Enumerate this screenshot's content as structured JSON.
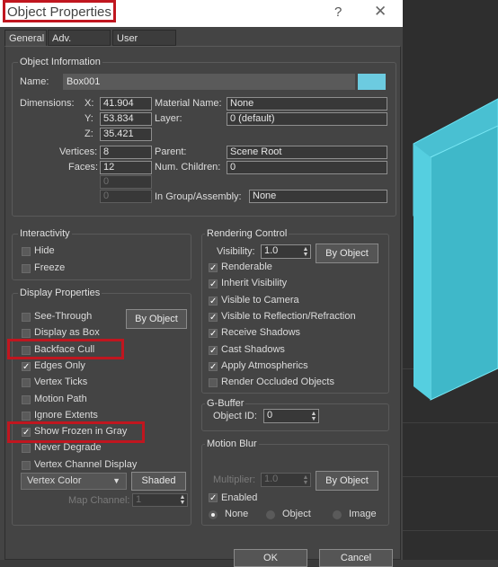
{
  "window": {
    "title": "Object Properties",
    "help": "?",
    "close": "✕"
  },
  "tabs": [
    "General",
    "Adv. Lighting",
    "User Defined"
  ],
  "object_info": {
    "group_title": "Object Information",
    "name_label": "Name:",
    "name_value": "Box001",
    "color": "#6ccbe0",
    "dimensions_label": "Dimensions:",
    "x_label": "X:",
    "x_value": "41.904",
    "y_label": "Y:",
    "y_value": "53.834",
    "z_label": "Z:",
    "z_value": "35.421",
    "material_label": "Material Name:",
    "material_value": "None",
    "layer_label": "Layer:",
    "layer_value": "0 (default)",
    "vertices_label": "Vertices:",
    "vertices_value": "8",
    "faces_label": "Faces:",
    "faces_value": "12",
    "extra1_value": "0",
    "extra2_value": "0",
    "parent_label": "Parent:",
    "parent_value": "Scene Root",
    "children_label": "Num. Children:",
    "children_value": "0",
    "group_label": "In Group/Assembly:",
    "group_value": "None"
  },
  "interactivity": {
    "title": "Interactivity",
    "items": [
      {
        "label": "Hide",
        "checked": false
      },
      {
        "label": "Freeze",
        "checked": false
      }
    ]
  },
  "display": {
    "title": "Display Properties",
    "by_object": "By Object",
    "items": [
      {
        "label": "See-Through",
        "checked": false
      },
      {
        "label": "Display as Box",
        "checked": false
      },
      {
        "label": "Backface Cull",
        "checked": false
      },
      {
        "label": "Edges Only",
        "checked": true
      },
      {
        "label": "Vertex Ticks",
        "checked": false
      },
      {
        "label": "Motion Path",
        "checked": false
      },
      {
        "label": "Ignore Extents",
        "checked": false
      },
      {
        "label": "Show Frozen in Gray",
        "checked": true
      },
      {
        "label": "Never Degrade",
        "checked": false
      },
      {
        "label": "Vertex Channel Display",
        "checked": false
      }
    ],
    "vertex_color": "Vertex Color",
    "shaded": "Shaded",
    "map_channel_label": "Map Channel:",
    "map_channel_value": "1"
  },
  "rendering": {
    "title": "Rendering Control",
    "visibility_label": "Visibility:",
    "visibility_value": "1.0",
    "by_object": "By Object",
    "items": [
      {
        "label": "Renderable",
        "checked": true
      },
      {
        "label": "Inherit Visibility",
        "checked": true
      },
      {
        "label": "Visible to Camera",
        "checked": true
      },
      {
        "label": "Visible to Reflection/Refraction",
        "checked": true
      },
      {
        "label": "Receive Shadows",
        "checked": true
      },
      {
        "label": "Cast Shadows",
        "checked": true
      },
      {
        "label": "Apply Atmospherics",
        "checked": true
      },
      {
        "label": "Render Occluded Objects",
        "checked": false
      }
    ]
  },
  "gbuffer": {
    "title": "G-Buffer",
    "object_id_label": "Object ID:",
    "object_id_value": "0"
  },
  "motion_blur": {
    "title": "Motion Blur",
    "multiplier_label": "Multiplier:",
    "multiplier_value": "1.0",
    "by_object": "By Object",
    "enabled_label": "Enabled",
    "enabled_checked": true,
    "options": [
      {
        "label": "None",
        "selected": true
      },
      {
        "label": "Object",
        "selected": false
      },
      {
        "label": "Image",
        "selected": false
      }
    ]
  },
  "footer": {
    "ok": "OK",
    "cancel": "Cancel"
  },
  "colors": {
    "highlight": "#c0161f",
    "cube": "#4fc3d4"
  }
}
